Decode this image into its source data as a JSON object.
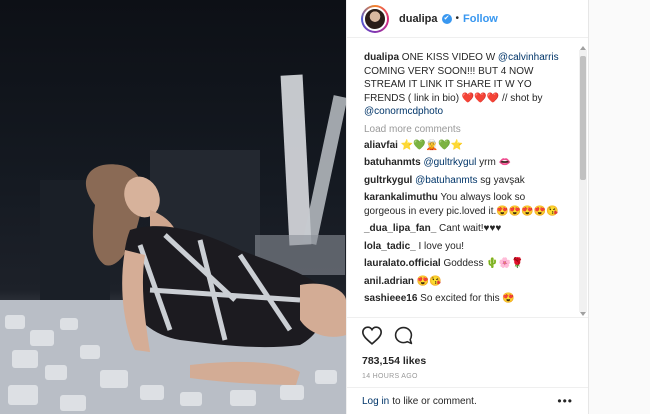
{
  "post": {
    "username": "dualipa",
    "verified_badge": "✔",
    "separator": "•",
    "follow_label": "Follow",
    "caption_user": "dualipa",
    "caption_text_1": " ONE KISS VIDEO W ",
    "caption_mention_1": "@calvinharris",
    "caption_text_2": " COMING VERY SOON!!! BUT 4 NOW STREAM IT LINK IT SHARE IT W YO FRENDS ( link in bio) ",
    "caption_hearts": "❤️❤️❤️",
    "caption_text_3": " // shot by ",
    "caption_mention_2": "@conormcdphoto",
    "load_more": "Load more comments",
    "comments": [
      {
        "user": "aliavfai",
        "text": " ⭐💚🧝💚⭐"
      },
      {
        "user": "batuhanmts",
        "mention": " @gultrkygul",
        "text": " yrm 👄"
      },
      {
        "user": "gultrkygul",
        "mention": " @batuhanmts",
        "text": " sg yavşak"
      },
      {
        "user": "karankalimuthu",
        "text": " You always look so gorgeous in every pic.loved it.😍😍😍😍😘"
      },
      {
        "user": "_dua_lipa_fan_",
        "text": " Cant wait!♥♥♥"
      },
      {
        "user": "lola_tadic_",
        "text": " I love you!"
      },
      {
        "user": "lauralato.official",
        "text": " Goddess 🌵🌸🌹"
      },
      {
        "user": "anil.adrian",
        "text": " 😍😘"
      },
      {
        "user": "sashieee16",
        "text": " So excited for this 😍"
      }
    ],
    "likes": "783,154 likes",
    "time": "14 HOURS AGO",
    "login_link": "Log in",
    "login_text": "to like or comment.",
    "more_icon": "•••",
    "icons": [
      "heart-icon",
      "comment-icon"
    ],
    "colors": {
      "link": "#003569",
      "follow": "#3897f0",
      "muted": "#999999"
    }
  }
}
